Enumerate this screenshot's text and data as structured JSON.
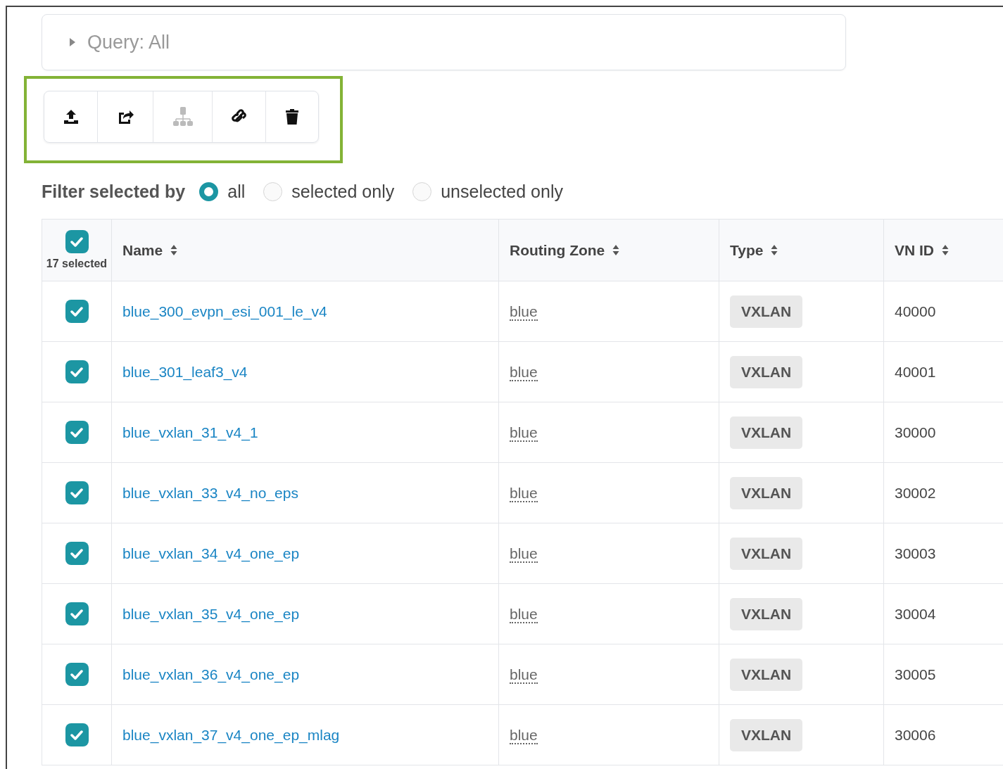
{
  "query": {
    "label": "Query: All",
    "expanded": false
  },
  "toolbar": {
    "highlighted": true,
    "buttons": [
      {
        "kind": "upload",
        "disabled": false
      },
      {
        "kind": "share",
        "disabled": false
      },
      {
        "kind": "hierarchy",
        "disabled": true
      },
      {
        "kind": "link",
        "disabled": false
      },
      {
        "kind": "trash",
        "disabled": false
      }
    ]
  },
  "filter": {
    "label": "Filter selected by",
    "options": [
      {
        "label": "all",
        "selected": true
      },
      {
        "label": "selected only",
        "selected": false
      },
      {
        "label": "unselected only",
        "selected": false
      }
    ]
  },
  "table": {
    "select_all": {
      "checked": true,
      "caption": "17 selected"
    },
    "columns": [
      {
        "label": "Name"
      },
      {
        "label": "Routing Zone"
      },
      {
        "label": "Type"
      },
      {
        "label": "VN ID"
      }
    ],
    "rows": [
      {
        "checked": true,
        "name": "blue_300_evpn_esi_001_le_v4",
        "routing_zone": "blue",
        "type": "VXLAN",
        "vn_id": "40000"
      },
      {
        "checked": true,
        "name": "blue_301_leaf3_v4",
        "routing_zone": "blue",
        "type": "VXLAN",
        "vn_id": "40001"
      },
      {
        "checked": true,
        "name": "blue_vxlan_31_v4_1",
        "routing_zone": "blue",
        "type": "VXLAN",
        "vn_id": "30000"
      },
      {
        "checked": true,
        "name": "blue_vxlan_33_v4_no_eps",
        "routing_zone": "blue",
        "type": "VXLAN",
        "vn_id": "30002"
      },
      {
        "checked": true,
        "name": "blue_vxlan_34_v4_one_ep",
        "routing_zone": "blue",
        "type": "VXLAN",
        "vn_id": "30003"
      },
      {
        "checked": true,
        "name": "blue_vxlan_35_v4_one_ep",
        "routing_zone": "blue",
        "type": "VXLAN",
        "vn_id": "30004"
      },
      {
        "checked": true,
        "name": "blue_vxlan_36_v4_one_ep",
        "routing_zone": "blue",
        "type": "VXLAN",
        "vn_id": "30005"
      },
      {
        "checked": true,
        "name": "blue_vxlan_37_v4_one_ep_mlag",
        "routing_zone": "blue",
        "type": "VXLAN",
        "vn_id": "30006"
      }
    ]
  }
}
